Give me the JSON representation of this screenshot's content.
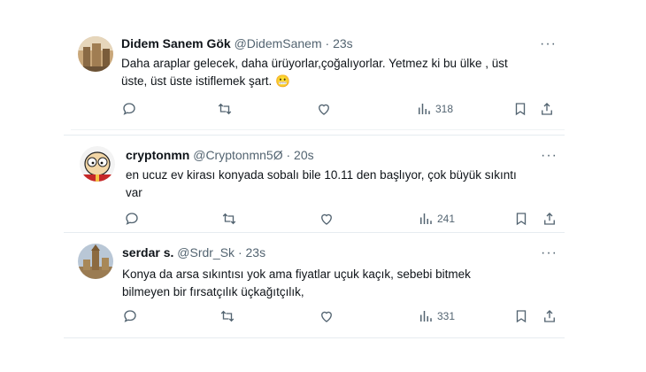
{
  "tweets": [
    {
      "name": "Didem Sanem Gök",
      "handle": "@DidemSanem",
      "sep": "·",
      "time": "23s",
      "text_line1": "Daha araplar gelecek, daha ürüyorlar,çoğalıyorlar. Yetmez ki bu ülke , üst",
      "text_line2": "üste, üst üste istiflemek şart. 😬",
      "views": "318",
      "more": "···"
    },
    {
      "name": "cryptonmn",
      "handle": "@Cryptonmn5Ø",
      "sep": "·",
      "time": "20s",
      "text_line1": "en ucuz ev kirası konyada sobalı bile 10.11 den başlıyor, çok büyük sıkıntı",
      "text_line2": "var",
      "views": "241",
      "more": "···"
    },
    {
      "name": "serdar s.",
      "handle": "@Srdr_Sk",
      "sep": "·",
      "time": "23s",
      "text_line1": "Konya da arsa sıkıntısı yok ama fiyatlar uçuk kaçık, sebebi bitmek",
      "text_line2": "bilmeyen bir fırsatçılık üçkağıtçılık,",
      "views": "331",
      "more": "···"
    }
  ],
  "icons": [
    "reply-icon",
    "retweet-icon",
    "like-icon",
    "views-icon",
    "bookmark-icon",
    "share-icon"
  ],
  "colors": {
    "text": "#0f1419",
    "muted": "#536471",
    "border": "#eff3f4"
  }
}
